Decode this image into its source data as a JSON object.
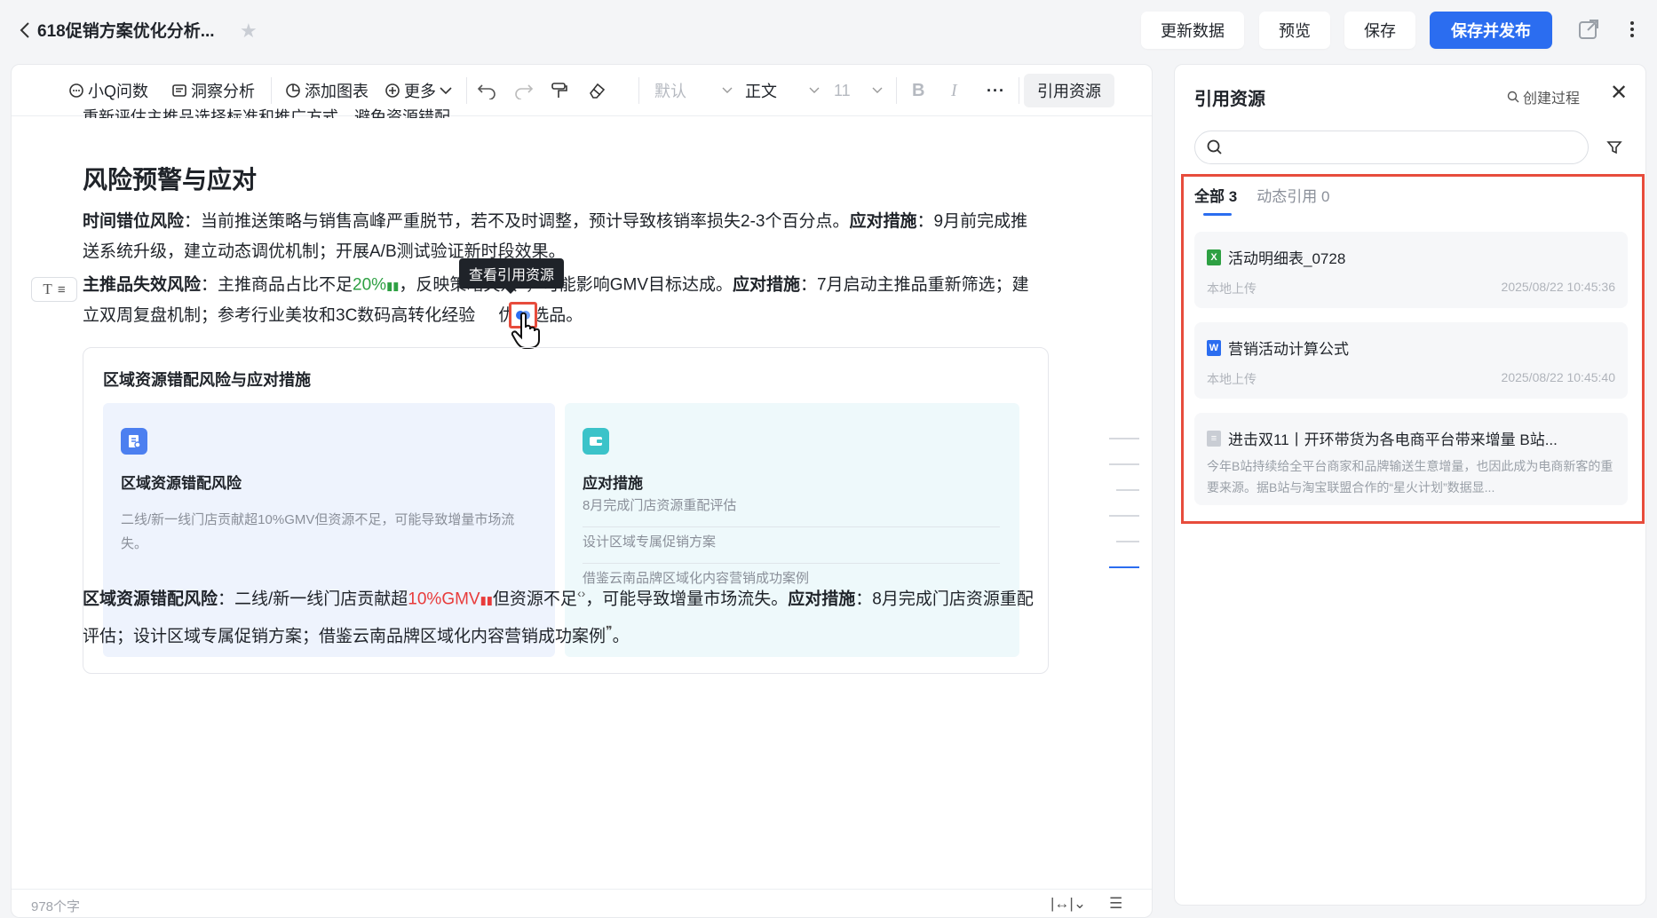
{
  "topbar": {
    "title": "618促销方案优化分析...",
    "buttons": {
      "update": "更新数据",
      "preview": "预览",
      "save": "保存",
      "save_publish": "保存并发布"
    }
  },
  "toolbar": {
    "ask": "小Q问数",
    "insight": "洞察分析",
    "add_chart": "添加图表",
    "more": "更多",
    "font": "默认",
    "style": "正文",
    "size": "11",
    "bold": "B",
    "italic": "I",
    "overflow": "···",
    "ref_resources": "引用资源"
  },
  "doc": {
    "clipped_line": "重新评估主推品选择标准和推广方式，避免资源错配。",
    "heading": "风险预警与应对",
    "p1": {
      "label1": "时间错位风险",
      "text1": "：当前推送策略与销售高峰严重脱节，若不及时调整，预计导致核销率损失2-3个百分点。",
      "label2": "应对措施",
      "text2": "：9月前完成推送系统升级，建立动态调优机制；开展A/B测试验证新时段效果。"
    },
    "p2": {
      "label1": "主推品失效风险",
      "text1a": "：主推商品占比不足",
      "value": "20%",
      "text1b": "，反映策略失效",
      "text1c": "，可能影响GMV目标达成。",
      "label2": "应对措施",
      "text2a": "：7月启动主推品重新筛选；建立双周复盘机制；参考行业美妆和3C数码高转化经验",
      "text2b": "优化选品。"
    },
    "tooltip": "查看引用资源",
    "card": {
      "title": "区域资源错配风险与应对措施",
      "left_head": "区域资源错配风险",
      "left_desc": "二线/新一线门店贡献超10%GMV但资源不足，可能导致增量市场流失。",
      "right_head": "应对措施",
      "right_items": [
        "8月完成门店资源重配评估",
        "设计区域专属促销方案",
        "借鉴云南品牌区域化内容营销成功案例"
      ]
    },
    "p3": {
      "label1": "区域资源错配风险",
      "text1a": "：二线/新一线门店贡献超",
      "value": "10%GMV",
      "text1b": "但资源不足",
      "text1c": "，可能导致增量市场流失。",
      "label2": "应对措施",
      "text2": "：8月完成门店资源重配评估；设计区域专属促销方案；借鉴云南品牌区域化内容营销成功案例",
      "end": "。"
    },
    "word_count": "978个字"
  },
  "panel": {
    "title": "引用资源",
    "create_process": "创建过程",
    "search_placeholder": "",
    "tabs": [
      {
        "label": "全部",
        "count": "3"
      },
      {
        "label": "动态引用",
        "count": "0"
      }
    ],
    "resources": [
      {
        "name": "活动明细表_0728",
        "source": "本地上传",
        "time": "2025/08/22 10:45:36",
        "icon": "excel-icon"
      },
      {
        "name": "营销活动计算公式",
        "source": "本地上传",
        "time": "2025/08/22 10:45:40",
        "icon": "word-icon"
      },
      {
        "name": "进击双11丨开环带货为各电商平台带来增量 B站...",
        "snippet": "今年B站持续给全平台商家和品牌输送生意增量，也因此成为电商新客的重要来源。据B站与淘宝联盟合作的“星火计划”数据显...",
        "icon": "doc-icon"
      }
    ]
  },
  "colors": {
    "accent": "#2b6df0",
    "highlight": "#e74c3c",
    "green": "#2ea043",
    "red": "#e83b3b"
  }
}
